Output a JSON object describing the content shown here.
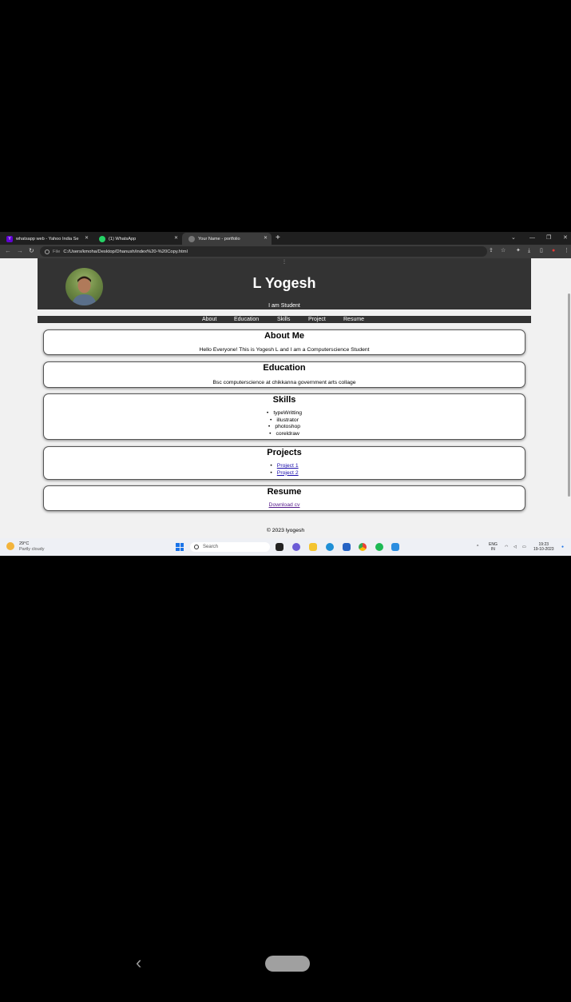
{
  "browser": {
    "tabs": [
      {
        "title": "whatsapp web - Yahoo India Se",
        "favicon": "yahoo-icon",
        "color": "#6001d2"
      },
      {
        "title": "(1) WhatsApp",
        "favicon": "whatsapp-icon",
        "color": "#25d366"
      },
      {
        "title": "Your Name - portfolio",
        "favicon": "globe-icon",
        "color": "#777777"
      }
    ],
    "address": {
      "scheme": "File",
      "url": "C:/Users/kmoha/Desktop/Dhanush/index%20-%20Copy.html"
    }
  },
  "page": {
    "header": {
      "title": "L Yogesh",
      "subtitle": "I am Student"
    },
    "nav": [
      "About",
      "Education",
      "Skills",
      "Project",
      "Resume"
    ],
    "about": {
      "heading": "About Me",
      "text": "Hello Everyone! This is Yogesh L and I am a Computerscience Student"
    },
    "education": {
      "heading": "Education",
      "text": "Bsc computerscience at chikkanna government arts collage"
    },
    "skills": {
      "heading": "Skills",
      "items": [
        "typeWritting",
        "illustrator",
        "photoshop",
        "coreldraw"
      ]
    },
    "projects": {
      "heading": "Projects",
      "items": [
        "Project 1",
        "Project 2"
      ]
    },
    "resume": {
      "heading": "Resume",
      "link": "Download cv"
    },
    "footer": "© 2023 lyogesh"
  },
  "taskbar": {
    "weather": {
      "temp": "29°C",
      "desc": "Partly cloudy"
    },
    "search_placeholder": "Search",
    "tray": {
      "lang": "ENG",
      "region": "IN",
      "time": "19:23",
      "date": "19-10-2023"
    }
  },
  "colors": {
    "header_bg": "#333333",
    "page_bg": "#f1f1f1",
    "link": "#1a0dab"
  }
}
